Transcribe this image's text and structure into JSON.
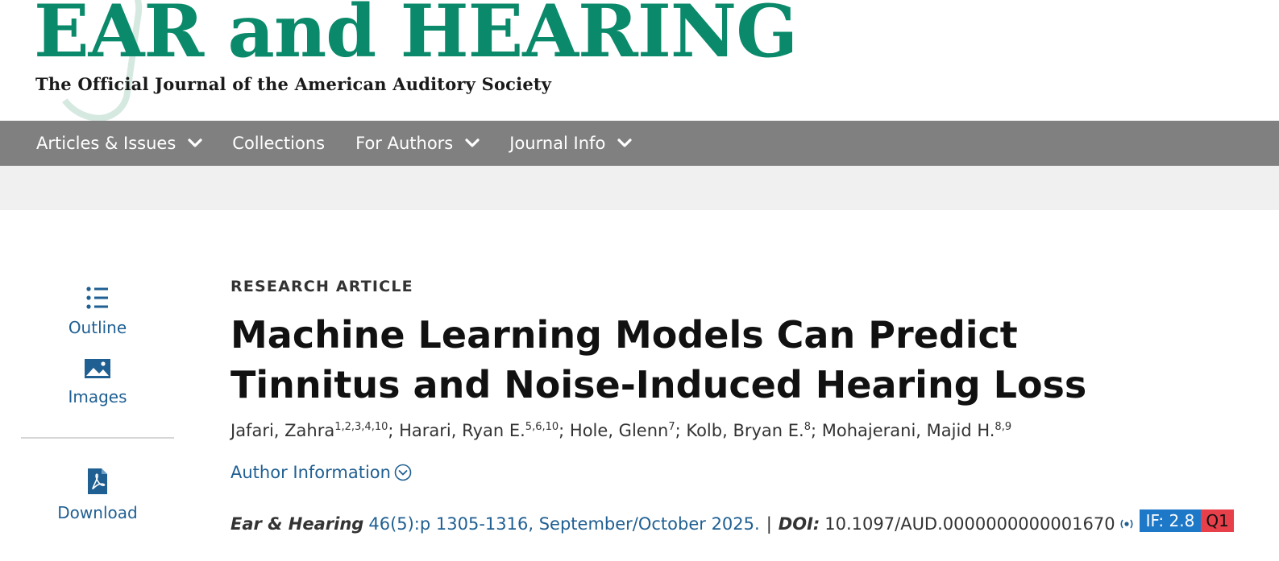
{
  "masthead": {
    "title": "EAR and HEARING",
    "subtitle": "The Official Journal of the American Auditory Society"
  },
  "nav": {
    "items": [
      {
        "label": "Articles & Issues",
        "has_dropdown": true
      },
      {
        "label": "Collections",
        "has_dropdown": false
      },
      {
        "label": "For Authors",
        "has_dropdown": true
      },
      {
        "label": "Journal Info",
        "has_dropdown": true
      }
    ]
  },
  "tools": {
    "outline_label": "Outline",
    "images_label": "Images",
    "download_label": "Download"
  },
  "article": {
    "type": "RESEARCH ARTICLE",
    "title": "Machine Learning Models Can Predict Tinnitus and Noise-Induced Hearing Loss",
    "authors": [
      {
        "name": "Jafari, Zahra",
        "affil": "1,2,3,4,10"
      },
      {
        "name": "Harari, Ryan E.",
        "affil": "5,6,10"
      },
      {
        "name": "Hole, Glenn",
        "affil": "7"
      },
      {
        "name": "Kolb, Bryan E.",
        "affil": "8"
      },
      {
        "name": "Mohajerani, Majid H.",
        "affil": "8,9"
      }
    ],
    "author_info_label": "Author Information",
    "citation": {
      "journal": "Ear & Hearing",
      "volume_pages": "46(5):p 1305-1316, September/October 2025.",
      "separator": "|",
      "doi_label": "DOI:",
      "doi": "10.1097/AUD.0000000000001670",
      "impact_factor": "IF: 2.8",
      "quartile": "Q1"
    }
  },
  "colors": {
    "brand_green": "#0a8a6a",
    "nav_gray": "#808080",
    "link_blue": "#1f5f92",
    "if_badge": "#1e78c8",
    "q_badge": "#e8404a"
  }
}
